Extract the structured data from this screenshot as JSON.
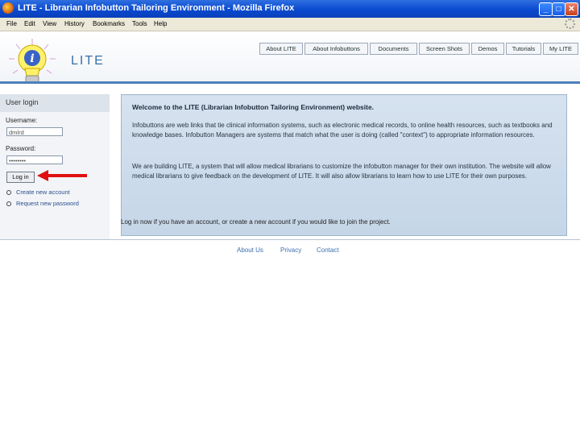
{
  "window": {
    "title": "LITE - Librarian Infobutton Tailoring Environment - Mozilla Firefox",
    "minimize_glyph": "_",
    "maximize_glyph": "□",
    "close_glyph": "✕"
  },
  "menu": [
    "File",
    "Edit",
    "View",
    "History",
    "Bookmarks",
    "Tools",
    "Help"
  ],
  "site": {
    "logo_text": "LITE",
    "nav": [
      "About LITE",
      "About Infobuttons",
      "Documents",
      "Screen Shots",
      "Demos",
      "Tutorials",
      "My LITE"
    ]
  },
  "login": {
    "title": "User login",
    "username_label": "Username:",
    "username_value": "dmlrd",
    "password_label": "Password:",
    "password_value": "••••••••",
    "login_button": "Log in",
    "links": [
      "Create new account",
      "Request new password"
    ]
  },
  "welcome": {
    "title": "Welcome to the LITE (Librarian Infobutton Tailoring Environment) website.",
    "paragraphs": [
      "Infobuttons are web links that tie clinical information systems, such as electronic medical records, to online health resources, such as textbooks and knowledge bases. Infobutton Managers are systems that match what the user is doing (called \"context\") to appropriate information resources.",
      "We are building LITE, a system that will allow medical librarians to customize the infobutton manager for their own institution. The website will allow medical librarians to give feedback on the development of LITE. It will also allow librarians to learn how to use LITE for their own purposes."
    ],
    "login_prompt": "Log in now if you have an account, or create a new account if you would like to join the project."
  },
  "footer": [
    "About Us",
    "Privacy",
    "Contact"
  ],
  "colors": {
    "titlebar": "#0a4ad0",
    "accent": "#4e7fbb",
    "welcome_bg": "#cddbeb",
    "arrow": "#e01010"
  }
}
